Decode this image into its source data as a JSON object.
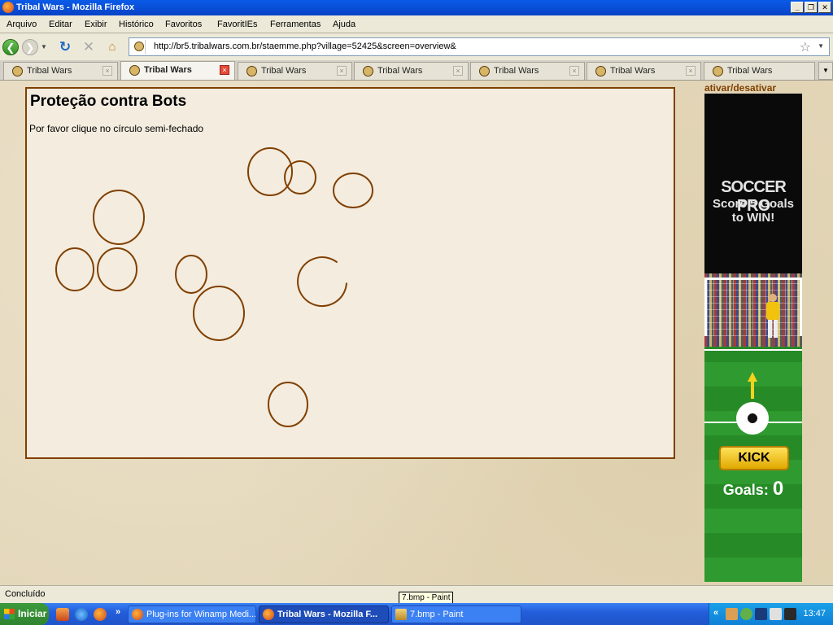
{
  "window": {
    "title": "Tribal Wars - Mozilla Firefox"
  },
  "menu": [
    "Arquivo",
    "Editar",
    "Exibir",
    "Histórico",
    "Favoritos",
    "FavoritIEs",
    "Ferramentas",
    "Ajuda"
  ],
  "address": {
    "url": "http://br5.tribalwars.com.br/staemme.php?village=52425&screen=overview&"
  },
  "tabs": [
    {
      "label": "Tribal Wars",
      "active": false
    },
    {
      "label": "Tribal Wars",
      "active": true
    },
    {
      "label": "Tribal Wars",
      "active": false
    },
    {
      "label": "Tribal Wars",
      "active": false
    },
    {
      "label": "Tribal Wars",
      "active": false
    },
    {
      "label": "Tribal Wars",
      "active": false
    },
    {
      "label": "Tribal Wars",
      "active": false
    }
  ],
  "page": {
    "title": "Proteção contra Bots",
    "instruction": "Por favor clique no círculo semi-fechado",
    "circle_color": "#804000",
    "border_color": "#804000",
    "circles": [
      {
        "id": "c1",
        "closed": true
      },
      {
        "id": "c2",
        "closed": true
      },
      {
        "id": "c3",
        "closed": true
      },
      {
        "id": "c4",
        "closed": true
      },
      {
        "id": "c5",
        "closed": true
      },
      {
        "id": "c6",
        "closed": true
      },
      {
        "id": "c7",
        "closed": true
      },
      {
        "id": "c8",
        "closed": false
      },
      {
        "id": "c9",
        "closed": true
      },
      {
        "id": "c10",
        "closed": true
      }
    ]
  },
  "ad": {
    "toggle": "ativar/desativar",
    "headline": "SOCCER PRO",
    "subline1": "Score 5 Goals",
    "subline2": "to WIN!",
    "kick": "KICK",
    "goals_label": "Goals:",
    "goals_value": "0"
  },
  "status": {
    "text": "Concluído"
  },
  "tooltip": "7.bmp - Paint",
  "taskbar": {
    "start": "Iniciar",
    "tasks": [
      "Plug-ins for Winamp Medi...",
      "Tribal Wars - Mozilla F...",
      "7.bmp - Paint"
    ],
    "active_task": 1,
    "clock": "13:47"
  }
}
